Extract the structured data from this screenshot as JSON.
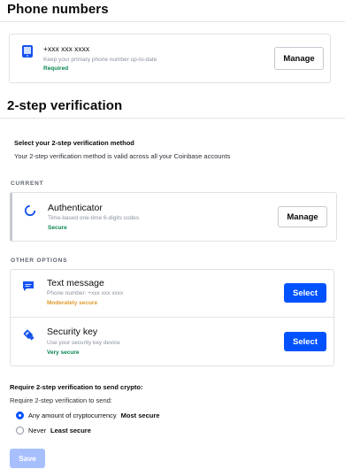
{
  "phone_section": {
    "heading": "Phone numbers",
    "phone": {
      "number": "+xxx xxx xxxx",
      "hint": "Keep your primary phone number up-to-date",
      "status": "Required",
      "manage_label": "Manage",
      "icon": "phone-icon"
    }
  },
  "twostep_section": {
    "heading": "2-step verification",
    "select_title": "Select your 2-step verification method",
    "select_desc": "Your 2-step verification method is valid across all your Coinbase accounts",
    "current_label": "CURRENT",
    "current": {
      "title": "Authenticator",
      "desc": "Time-based one-time 6-digits codes",
      "status": "Secure",
      "button": "Manage",
      "icon": "authenticator-icon"
    },
    "other_label": "OTHER OPTIONS",
    "options": [
      {
        "title": "Text message",
        "desc": "Phone number: +xxx xxx xxxx",
        "status": "Moderately secure",
        "button": "Select",
        "icon": "chat-bubble-icon"
      },
      {
        "title": "Security key",
        "desc": "Use your security key device",
        "status": "Very secure",
        "button": "Select",
        "icon": "security-key-icon"
      }
    ]
  },
  "crypto_send": {
    "title": "Require 2-step verification to send crypto:",
    "subtitle": "Require 2-step verification to send:",
    "choices": [
      {
        "label": "Any amount of cryptocurrency",
        "note": "Most secure",
        "selected": true
      },
      {
        "label": "Never",
        "note": "Least secure",
        "selected": false
      }
    ],
    "save_label": "Save"
  },
  "colors": {
    "accent": "#0052ff",
    "secure_green": "#098551",
    "moderate_orange": "#e09b2d",
    "danger_red": "#cf202f"
  }
}
